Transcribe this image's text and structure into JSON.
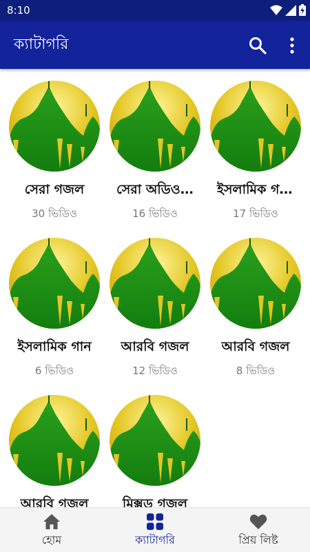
{
  "status_bar": {
    "time": "8:10"
  },
  "app_bar": {
    "title": "ক্যাটাগরি",
    "search_icon": "search-icon",
    "more_icon": "more-vert-icon"
  },
  "categories": [
    {
      "name": "সেরা গজল",
      "count": "30 ভিডিও"
    },
    {
      "name": "সেরা অডিও গজল",
      "count": "16 ভিডিও"
    },
    {
      "name": "ইসলামিক গজল",
      "count": "17 ভিডিও"
    },
    {
      "name": "ইসলামিক গান",
      "count": "6 ভিডিও"
    },
    {
      "name": "আরবি গজল",
      "count": "12 ভিডিও"
    },
    {
      "name": "আরবি গজল",
      "count": "8 ভিডিও"
    },
    {
      "name": "আরবি গজল",
      "count": ""
    },
    {
      "name": "মিক্সড গজল",
      "count": ""
    }
  ],
  "bottom_nav": {
    "home": "হোম",
    "category": "ক্যাটাগরি",
    "favorites": "প্রিয় লিষ্ট"
  },
  "colors": {
    "status_bar": "#0d1f7a",
    "app_bar": "#13239c",
    "accent": "#13239c",
    "thumb_gold": "#e3c623",
    "thumb_green": "#1a8f13"
  }
}
